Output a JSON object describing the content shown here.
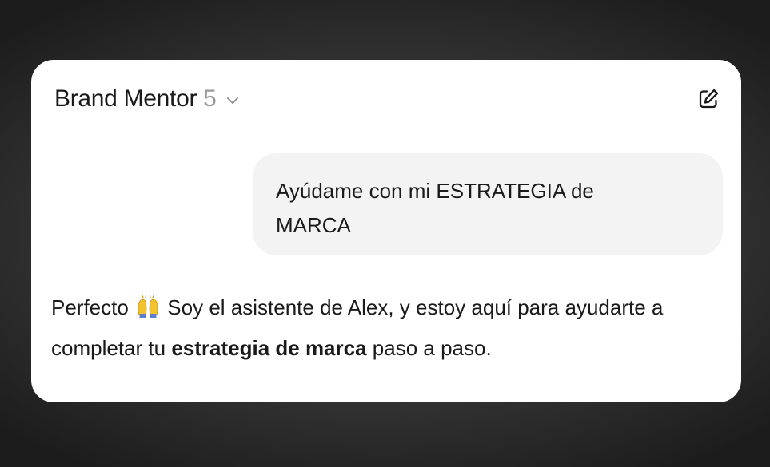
{
  "header": {
    "model_name": "Brand Mentor",
    "model_version": "5",
    "chevron_icon": "chevron-down-icon",
    "new_chat_icon": "edit-icon"
  },
  "user_message": {
    "text": "Ayúdame con mi ESTRATEGIA de MARCA"
  },
  "assistant_message": {
    "part1": "Perfecto",
    "emoji_icon": "raising-hands-icon",
    "part2": "Soy el asistente de Alex, y estoy aquí para ayudarte a completar tu",
    "bold": "estrategia de marca",
    "part3": "paso a paso."
  },
  "colors": {
    "card_background": "#ffffff",
    "bubble_background": "#f3f3f3",
    "text": "#1a1a1a",
    "muted": "#9a9a9a"
  }
}
